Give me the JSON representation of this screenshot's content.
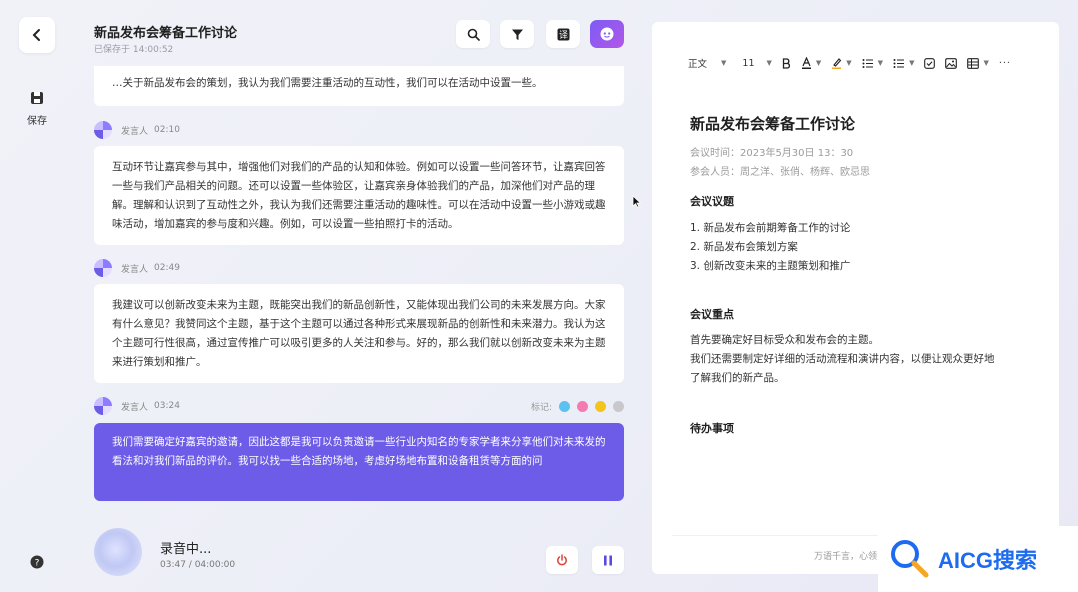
{
  "rail": {
    "save_label": "保存"
  },
  "header": {
    "title": "新品发布会筹备工作讨论",
    "saved": "已保存于 14:00:52"
  },
  "transcript": {
    "cards": [
      {
        "text": "…关于新品发布会的策划，我认为我们需要注重活动的互动性，我们可以在活动中设置一些。"
      },
      {
        "speaker": "发言人",
        "time": "02:10",
        "text": "互动环节让嘉宾参与其中，增强他们对我们的产品的认知和体验。例如可以设置一些问答环节，让嘉宾回答一些与我们产品相关的问题。还可以设置一些体验区，让嘉宾亲身体验我们的产品，加深他们对产品的理解。理解和认识到了互动性之外，我认为我们还需要注重活动的趣味性。可以在活动中设置一些小游戏或趣味活动，增加嘉宾的参与度和兴趣。例如，可以设置一些拍照打卡的活动。"
      },
      {
        "speaker": "发言人",
        "time": "02:49",
        "text": "我建议可以创新改变未来为主题，既能突出我们的新品创新性，又能体现出我们公司的未来发展方向。大家有什么意见？我赞同这个主题，基于这个主题可以通过各种形式来展现新品的创新性和未来潜力。我认为这个主题可行性很高，通过宣传推广可以吸引更多的人关注和参与。好的，那么我们就以创新改变未来为主题来进行策划和推广。"
      },
      {
        "speaker": "发言人",
        "time": "03:24",
        "mark_label": "标记:",
        "text": "我们需要确定好嘉宾的邀请，因此这都是我可以负责邀请一些行业内知名的专家学者来分享他们对未来发的看法和对我们新品的评价。我可以找一些合适的场地，考虑好场地布置和设备租赁等方面的问"
      }
    ]
  },
  "recording": {
    "title": "录音中...",
    "time": "03:47 / 04:00:00"
  },
  "editor": {
    "toolbar": {
      "style": "正文",
      "size": "11"
    },
    "doc_title": "新品发布会筹备工作讨论",
    "meeting_time": "会议时间：2023年5月30日 13：30",
    "attendees": "参会人员：周之洋、张俏、杨辉、欧忌思",
    "section_topics": "会议议题",
    "topics": [
      "1.  新品发布会前期筹备工作的讨论",
      "2.  新品发布会策划方案",
      "3.  创新改变未来的主题策划和推广"
    ],
    "section_focus": "会议重点",
    "focus_lines": [
      "首先要确定好目标受众和发布会的主题。",
      "我们还需要制定好详细的活动流程和演讲内容，以便让观众更好地",
      "了解我们的新产品。"
    ],
    "section_todo": "待办事项",
    "footer": "万语千言，心领"
  },
  "watermark": {
    "text": "AICG搜索"
  },
  "colors": {
    "accent": "#6c5ce7",
    "watermark": "#1d6cf0"
  }
}
